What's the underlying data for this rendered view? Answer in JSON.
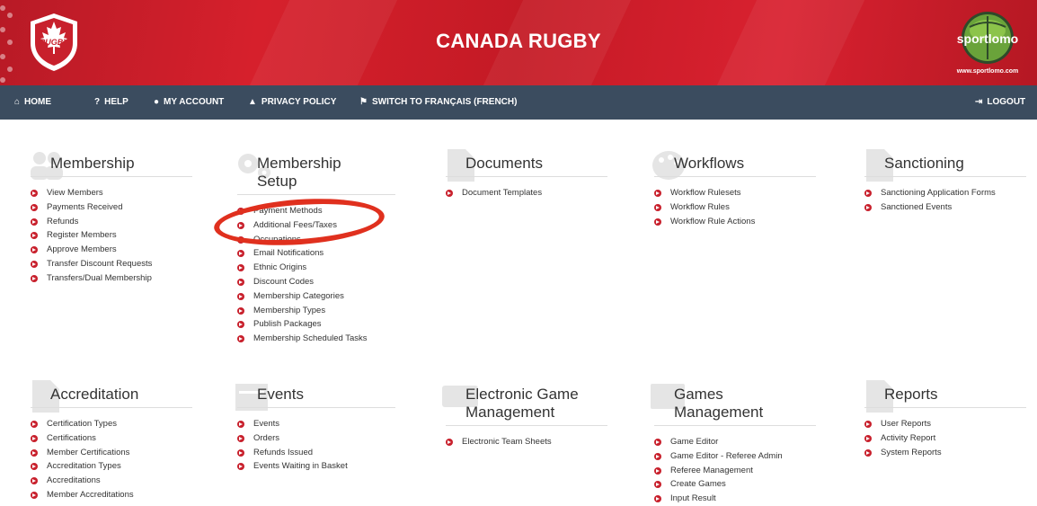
{
  "header": {
    "title": "CANADA RUGBY",
    "logo_text": "RUGBY",
    "partner_logo_text": "sportlomo",
    "partner_url": "www.sportlomo.com"
  },
  "nav": {
    "home": "HOME",
    "help": "HELP",
    "account": "MY ACCOUNT",
    "privacy": "PRIVACY POLICY",
    "language": "SWITCH TO FRANÇAIS (FRENCH)",
    "logout": "LOGOUT"
  },
  "colors": {
    "brand_red": "#c8202c",
    "nav_bg": "#3b4c5f",
    "annotation": "#e0301e"
  },
  "modules": {
    "membership": {
      "title": "Membership",
      "links": [
        "View Members",
        "Payments Received",
        "Refunds",
        "Register Members",
        "Approve Members",
        "Transfer Discount Requests",
        "Transfers/Dual Membership"
      ]
    },
    "membership_setup": {
      "title": "Membership Setup",
      "links": [
        "Payment Methods",
        "Additional Fees/Taxes",
        "Occupations",
        "Email Notifications",
        "Ethnic Origins",
        "Discount Codes",
        "Membership Categories",
        "Membership Types",
        "Publish Packages",
        "Membership Scheduled Tasks"
      ]
    },
    "documents": {
      "title": "Documents",
      "links": [
        "Document Templates"
      ]
    },
    "workflows": {
      "title": "Workflows",
      "links": [
        "Workflow Rulesets",
        "Workflow Rules",
        "Workflow Rule Actions"
      ]
    },
    "sanctioning": {
      "title": "Sanctioning",
      "links": [
        "Sanctioning Application Forms",
        "Sanctioned Events"
      ]
    },
    "accreditation": {
      "title": "Accreditation",
      "links": [
        "Certification Types",
        "Certifications",
        "Member Certifications",
        "Accreditation Types",
        "Accreditations",
        "Member Accreditations"
      ]
    },
    "events": {
      "title": "Events",
      "links": [
        "Events",
        "Orders",
        "Refunds Issued",
        "Events Waiting in Basket"
      ]
    },
    "egm": {
      "title": "Electronic Game Management",
      "links": [
        "Electronic Team Sheets"
      ]
    },
    "games": {
      "title": "Games Management",
      "links": [
        "Game Editor",
        "Game Editor - Referee Admin",
        "Referee Management",
        "Create Games",
        "Input Result"
      ]
    },
    "reports": {
      "title": "Reports",
      "links": [
        "User Reports",
        "Activity Report",
        "System Reports"
      ]
    }
  }
}
